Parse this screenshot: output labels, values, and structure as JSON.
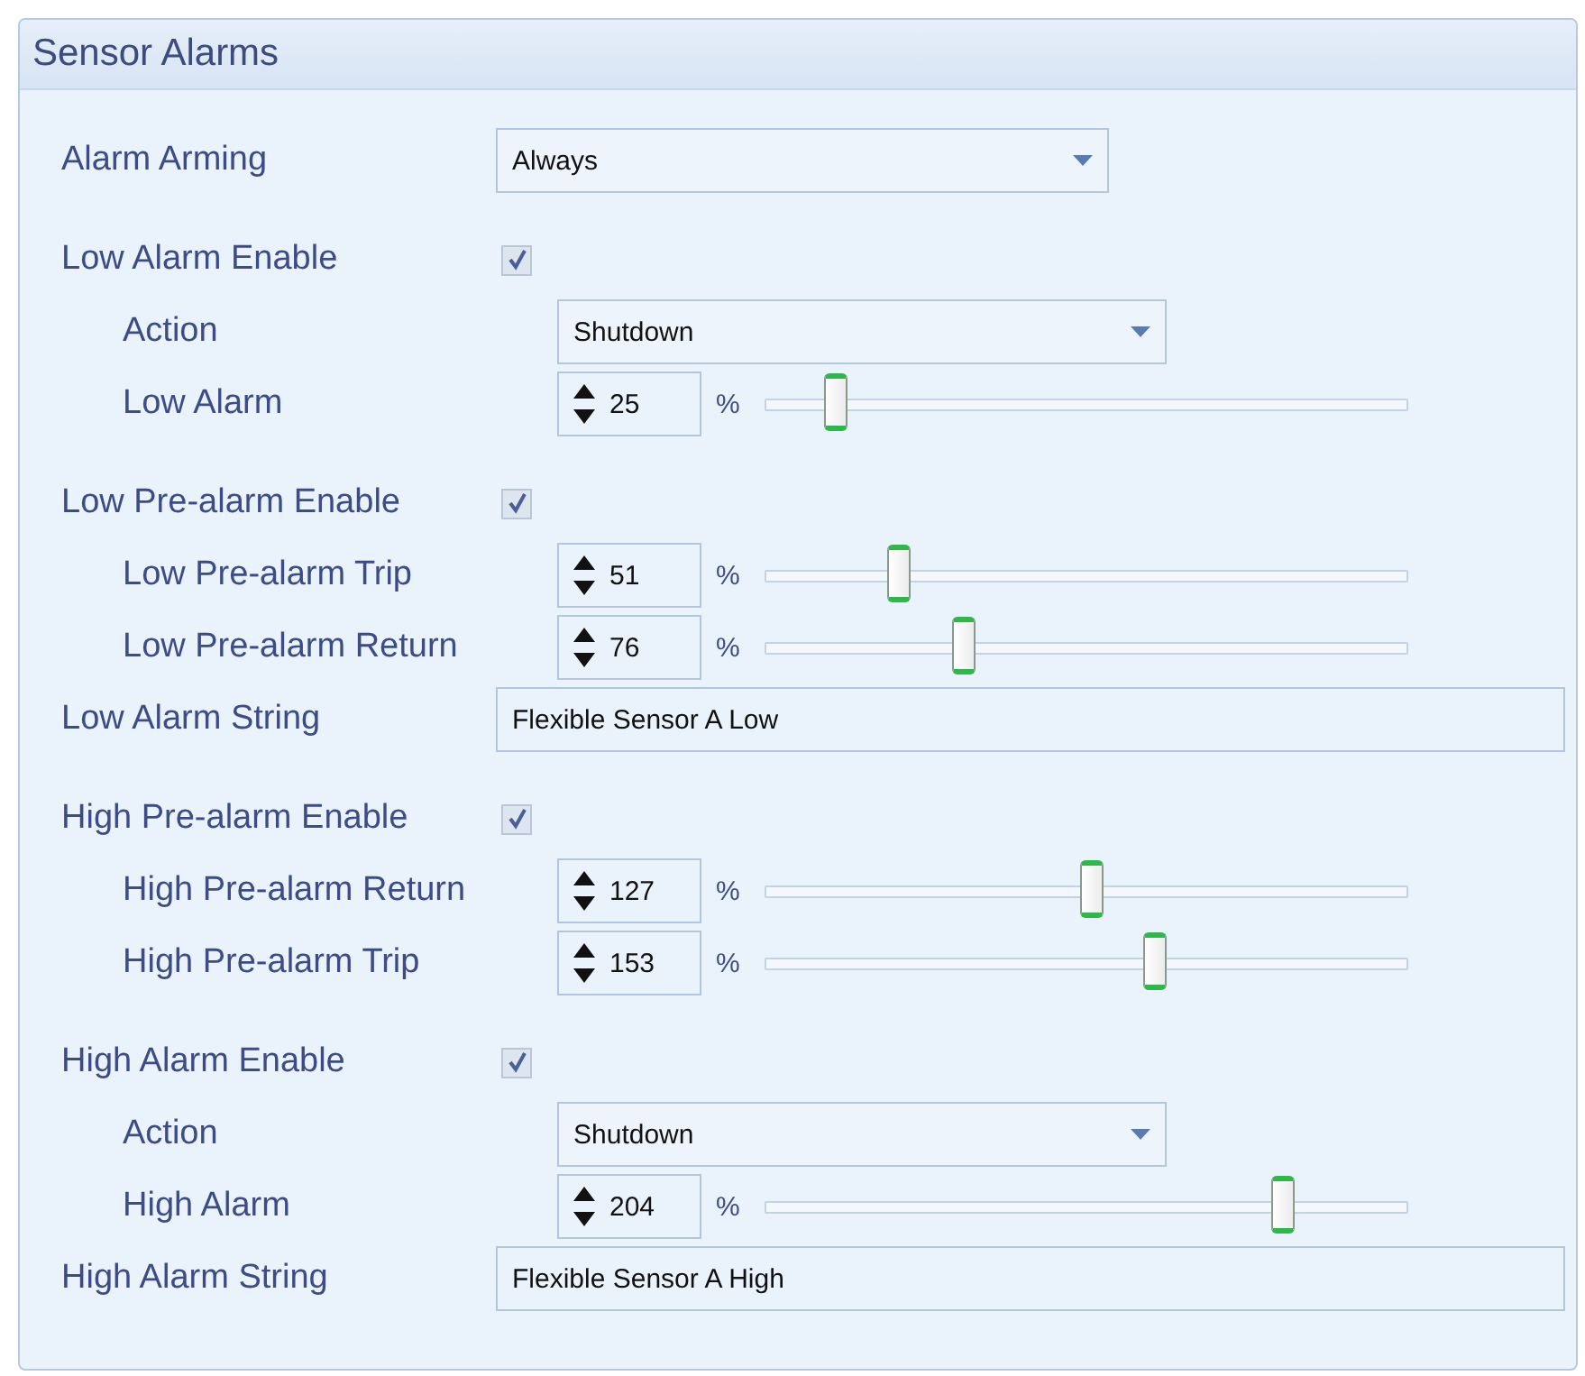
{
  "panel": {
    "title": "Sensor Alarms"
  },
  "sections": [
    {
      "rows": [
        {
          "kind": "select",
          "label": "Alarm Arming",
          "value": "Always"
        }
      ]
    },
    {
      "rows": [
        {
          "kind": "check",
          "label": "Low Alarm Enable",
          "checked": true,
          "children": [
            {
              "kind": "select",
              "label": "Action",
              "value": "Shutdown"
            },
            {
              "kind": "spin",
              "label": "Low Alarm",
              "value": "25",
              "unit": "%",
              "level": 0.1
            }
          ]
        }
      ]
    },
    {
      "rows": [
        {
          "kind": "check",
          "label": "Low Pre-alarm Enable",
          "checked": true,
          "children": [
            {
              "kind": "spin",
              "label": "Low Pre-alarm Trip",
              "value": "51",
              "unit": "%",
              "level": 0.2
            },
            {
              "kind": "spin",
              "label": "Low Pre-alarm Return",
              "value": "76",
              "unit": "%",
              "level": 0.3
            }
          ]
        },
        {
          "kind": "text",
          "label": "Low Alarm String",
          "value": "Flexible Sensor A Low"
        }
      ]
    },
    {
      "rows": [
        {
          "kind": "check",
          "label": "High Pre-alarm Enable",
          "checked": true,
          "children": [
            {
              "kind": "spin",
              "label": "High Pre-alarm Return",
              "value": "127",
              "unit": "%",
              "level": 0.5
            },
            {
              "kind": "spin",
              "label": "High Pre-alarm Trip",
              "value": "153",
              "unit": "%",
              "level": 0.6
            }
          ]
        }
      ]
    },
    {
      "rows": [
        {
          "kind": "check",
          "label": "High Alarm Enable",
          "checked": true,
          "children": [
            {
              "kind": "select",
              "label": "Action",
              "value": "Shutdown"
            },
            {
              "kind": "spin",
              "label": "High Alarm",
              "value": "204",
              "unit": "%",
              "level": 0.8
            }
          ]
        },
        {
          "kind": "text",
          "label": "High Alarm String",
          "value": "Flexible Sensor A High"
        }
      ]
    }
  ]
}
